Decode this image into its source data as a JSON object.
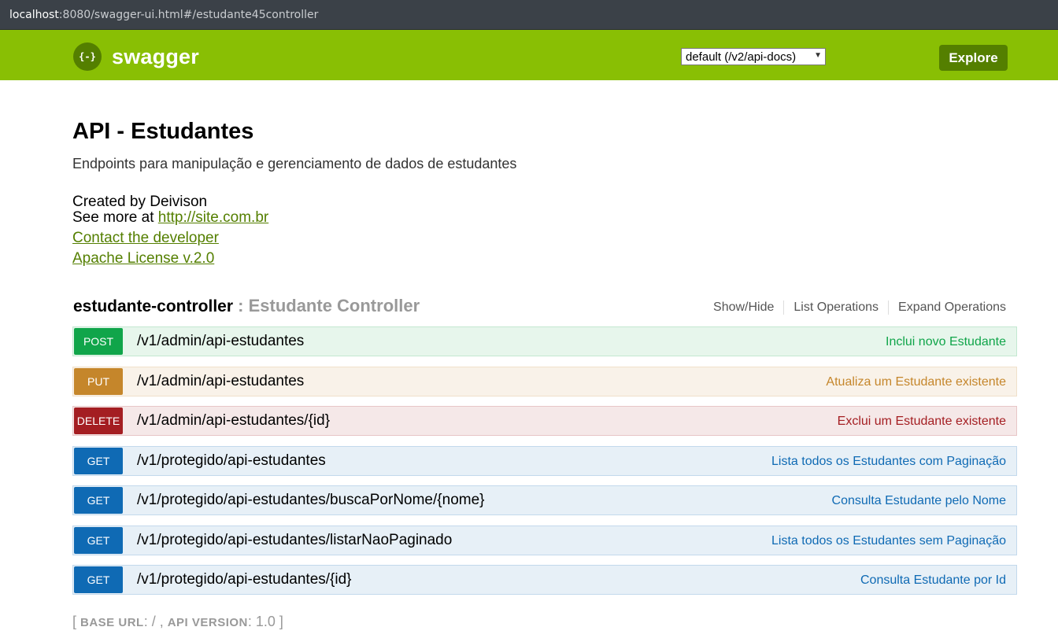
{
  "browser": {
    "url_host": "localhost",
    "url_rest": ":8080/swagger-ui.html#/estudante45controller"
  },
  "header": {
    "logo_glyph": "{-}",
    "logo_text": "swagger",
    "spec_selected": "default (/v2/api-docs)",
    "explore_label": "Explore"
  },
  "info": {
    "title": "API - Estudantes",
    "description": "Endpoints para manipulação e gerenciamento de dados de estudantes",
    "created_by": "Created by Deivison",
    "see_more_prefix": "See more at ",
    "see_more_link": "http://site.com.br",
    "contact_link": "Contact the developer",
    "license_link": "Apache License v.2.0"
  },
  "controller": {
    "name": "estudante-controller",
    "separator": " : Estudante Controller",
    "actions": [
      "Show/Hide",
      "List Operations",
      "Expand Operations"
    ]
  },
  "operations": [
    {
      "method": "POST",
      "path": "/v1/admin/api-estudantes",
      "summary": "Inclui novo Estudante"
    },
    {
      "method": "PUT",
      "path": "/v1/admin/api-estudantes",
      "summary": "Atualiza um Estudante existente"
    },
    {
      "method": "DELETE",
      "path": "/v1/admin/api-estudantes/{id}",
      "summary": "Exclui um Estudante existente"
    },
    {
      "method": "GET",
      "path": "/v1/protegido/api-estudantes",
      "summary": "Lista todos os Estudantes com Paginação"
    },
    {
      "method": "GET",
      "path": "/v1/protegido/api-estudantes/buscaPorNome/{nome}",
      "summary": "Consulta Estudante pelo Nome"
    },
    {
      "method": "GET",
      "path": "/v1/protegido/api-estudantes/listarNaoPaginado",
      "summary": "Lista todos os Estudantes sem Paginação"
    },
    {
      "method": "GET",
      "path": "/v1/protegido/api-estudantes/{id}",
      "summary": "Consulta Estudante por Id"
    }
  ],
  "footer": {
    "open": "[ ",
    "base_url_label": "BASE URL",
    "base_url_value": ": / , ",
    "api_version_label": "API VERSION",
    "api_version_value": ": 1.0 ]"
  },
  "colors": {
    "header_bg": "#89bf04",
    "accent_dark": "#547f00",
    "post": "#10a54a",
    "put": "#c5862b",
    "delete": "#a41e22",
    "get": "#0f6ab4"
  }
}
